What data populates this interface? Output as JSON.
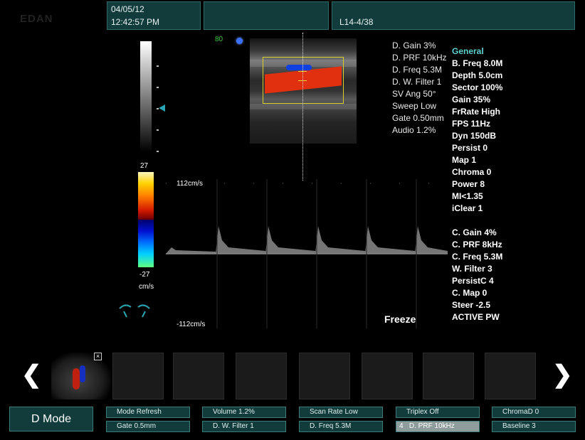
{
  "header": {
    "date": "04/05/12",
    "time": "12:42:57 PM",
    "probe": "L14-4/38"
  },
  "image_top": {
    "frame_indicator": "80"
  },
  "scale": {
    "top_value": "27",
    "bottom_value": "-27",
    "unit": "cm/s"
  },
  "doppler": {
    "top_velocity": "112cm/s",
    "bottom_velocity": "-112cm/s",
    "status": "Freeze"
  },
  "doppler_params": [
    "D. Gain 3%",
    "D. PRF 10kHz",
    "D. Freq 5.3M",
    "D. W. Filter 1",
    "SV Ang 50°",
    "Sweep Low",
    "Gate 0.50mm",
    "Audio 1.2%"
  ],
  "general_params": {
    "heading": "General",
    "items": [
      "B. Freq 8.0M",
      "Depth 5.0cm",
      "Sector 100%",
      "Gain 35%",
      "FrRate High",
      "FPS 11Hz",
      "Dyn 150dB",
      "Persist 0",
      "Map 1",
      "Chroma 0",
      "Power 8",
      "MI<1.35",
      "iClear 1"
    ],
    "color_items": [
      "C. Gain 4%",
      "C. PRF 8kHz",
      "C. Freq 5.3M",
      "W. Filter 3",
      "PersistC 4",
      "C. Map 0",
      "Steer -2.5",
      "ACTIVE PW"
    ]
  },
  "controls": {
    "mode": "D Mode",
    "row1": [
      "Mode Refresh",
      "Volume 1.2%",
      "Scan Rate Low",
      "Triplex Off",
      "ChromaD 0"
    ],
    "row2": [
      "Gate 0.5mm",
      "D. W. Filter 1",
      "D. Freq 5.3M",
      "D. PRF 10kHz",
      "Baseline 3"
    ],
    "selected_index_label": "4"
  },
  "colors": {
    "panel": "#123c3c",
    "accent": "#5fd0d0",
    "flow_red": "#e03010",
    "flow_blue": "#1040e0"
  }
}
